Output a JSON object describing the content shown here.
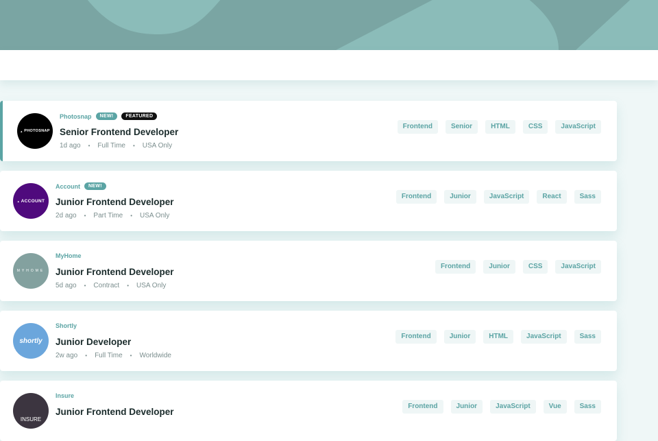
{
  "jobs": [
    {
      "company": "Photosnap",
      "logo_text": "PHOTOSNAP",
      "logo_color": "#000000",
      "is_new": true,
      "is_featured": true,
      "new_label": "NEW!",
      "featured_label": "FEATURED",
      "position": "Senior Frontend Developer",
      "posted": "1d ago",
      "contract": "Full Time",
      "location": "USA Only",
      "tags": [
        "Frontend",
        "Senior",
        "HTML",
        "CSS",
        "JavaScript"
      ]
    },
    {
      "company": "Account",
      "logo_text": "ACCOUNT",
      "logo_color": "#4f0a7d",
      "is_new": true,
      "is_featured": false,
      "new_label": "NEW!",
      "position": "Junior Frontend Developer",
      "posted": "2d ago",
      "contract": "Part Time",
      "location": "USA Only",
      "tags": [
        "Frontend",
        "Junior",
        "JavaScript",
        "React",
        "Sass"
      ]
    },
    {
      "company": "MyHome",
      "logo_text": "MYHOME",
      "logo_color": "#83a19f",
      "is_new": false,
      "is_featured": false,
      "position": "Junior Frontend Developer",
      "posted": "5d ago",
      "contract": "Contract",
      "location": "USA Only",
      "tags": [
        "Frontend",
        "Junior",
        "CSS",
        "JavaScript"
      ]
    },
    {
      "company": "Shortly",
      "logo_text": "shortly",
      "logo_color": "#6ba6dc",
      "is_new": false,
      "is_featured": false,
      "position": "Junior Developer",
      "posted": "2w ago",
      "contract": "Full Time",
      "location": "Worldwide",
      "tags": [
        "Frontend",
        "Junior",
        "HTML",
        "JavaScript",
        "Sass"
      ]
    },
    {
      "company": "Insure",
      "logo_text": "INSURE",
      "logo_color": "#3c3540",
      "is_new": false,
      "is_featured": false,
      "position": "Junior Frontend Developer",
      "posted": "",
      "contract": "",
      "location": "",
      "tags": [
        "Frontend",
        "Junior",
        "JavaScript",
        "Vue",
        "Sass"
      ]
    }
  ],
  "colors": {
    "primary": "#5ba4a4",
    "header_bg": "#7aa5a3",
    "page_bg": "#eff7f7",
    "tag_bg": "#eff6f6",
    "title": "#1a2b2b",
    "meta": "#7b8e8e"
  }
}
